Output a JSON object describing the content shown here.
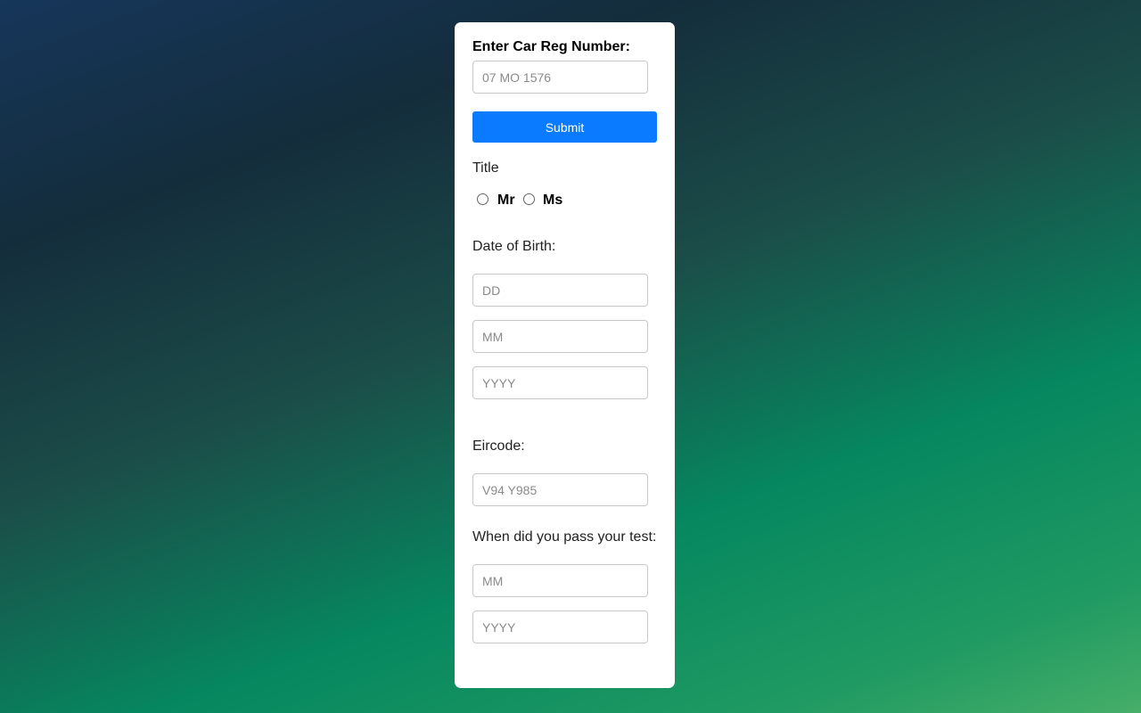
{
  "form": {
    "reg_label": "Enter Car Reg Number:",
    "reg_placeholder": "07 MO 1576",
    "submit_label": "Submit",
    "title_label": "Title",
    "title_options": [
      "Mr",
      "Ms"
    ],
    "dob_label": "Date of Birth:",
    "dob_day_placeholder": "DD",
    "dob_month_placeholder": "MM",
    "dob_year_placeholder": "YYYY",
    "eircode_label": "Eircode:",
    "eircode_placeholder": "V94 Y985",
    "test_label": "When did you pass your test:",
    "test_month_placeholder": "MM",
    "test_year_placeholder": "YYYY"
  },
  "colors": {
    "submit_bg": "#0a7bff",
    "card_bg": "#ffffff"
  }
}
